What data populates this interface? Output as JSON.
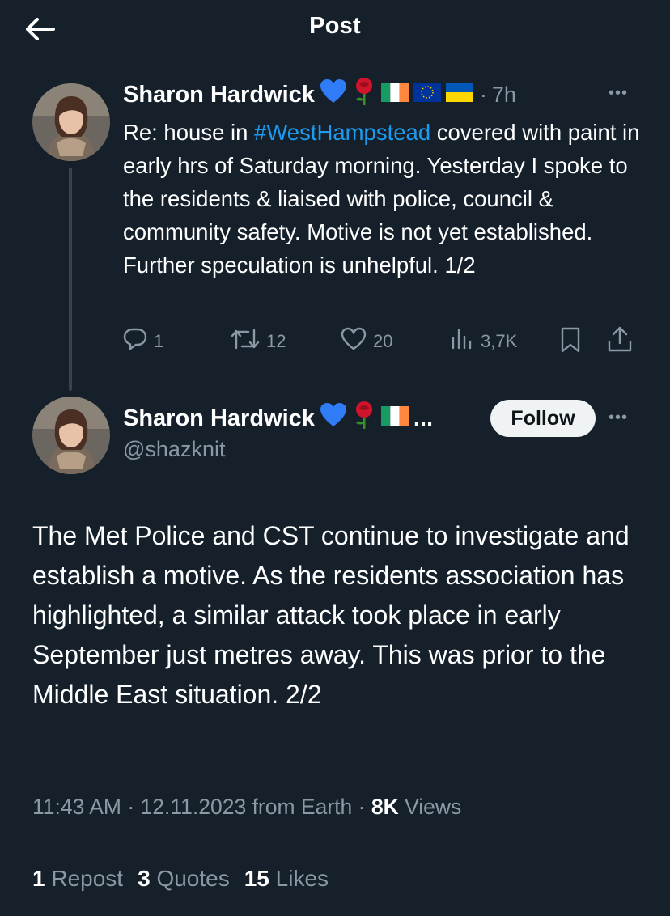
{
  "header": {
    "title": "Post"
  },
  "reply_tweet": {
    "author_name": "Sharon Hardwick",
    "time": "7h",
    "text_before_tag": "Re: house in ",
    "hashtag": "#WestHampstead",
    "text_after_tag": " covered with paint in early hrs of Saturday morning. Yesterday I spoke to the residents & liaised with police, council & community safety. Motive is not yet established. Further speculation is unhelpful. 1/2",
    "replies": "1",
    "reposts": "12",
    "likes": "20",
    "views": "3,7K"
  },
  "main_tweet": {
    "author_name": "Sharon Hardwick",
    "name_ellipsis": "...",
    "handle": "@shazknit",
    "follow_label": "Follow",
    "text": "The Met Police and CST continue to investigate and establish a motive. As the residents association has highlighted, a similar attack took place in early September just metres away. This was prior to the Middle East situation. 2/2",
    "timestamp": "11:43 AM · 12.11.2023 from Earth · ",
    "views_count": "8K",
    "views_label": "Views",
    "repost_count": "1",
    "repost_label": "Repost",
    "quotes_count": "3",
    "quotes_label": "Quotes",
    "likes_count": "15",
    "likes_label": "Likes"
  },
  "colors": {
    "background": "#15202b",
    "link": "#1d9bf0",
    "muted": "#8b98a5",
    "divider": "#38444d"
  },
  "icons": [
    "back-arrow-icon",
    "reply-icon",
    "repost-icon",
    "like-icon",
    "views-icon",
    "bookmark-icon",
    "share-icon",
    "more-icon",
    "blue-heart-icon",
    "rose-icon",
    "ireland-flag-icon",
    "eu-flag-icon",
    "ukraine-flag-icon"
  ]
}
